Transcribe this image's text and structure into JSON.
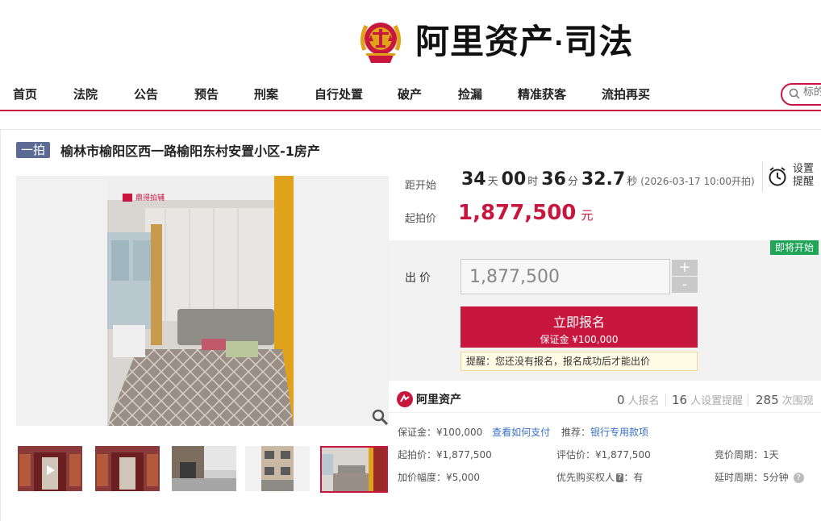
{
  "brand": {
    "name": "阿里资产",
    "dot": "·",
    "sub": "司法"
  },
  "nav": {
    "items": [
      "首页",
      "法院",
      "公告",
      "预告",
      "刑案",
      "自行处置",
      "破产",
      "捡漏",
      "精准获客",
      "流拍再买"
    ],
    "search_placeholder": "标的"
  },
  "listing": {
    "badge": "一拍",
    "title": "榆林市榆阳区西一路榆阳东村安置小区-1房产",
    "watermark": "鼎得拍辅"
  },
  "countdown": {
    "label": "距开始",
    "days": "34",
    "days_unit": "天",
    "hours": "00",
    "hours_unit": "时",
    "minutes": "36",
    "minutes_unit": "分",
    "seconds": "32.7",
    "seconds_unit": "秒",
    "note": "(2026-03-17 10:00开拍)"
  },
  "reminder": {
    "line1": "设置",
    "line2": "提醒"
  },
  "price": {
    "label": "起拍价",
    "value": "1,877,500",
    "unit": "元"
  },
  "bid": {
    "status_tag": "即将开始",
    "label": "出价",
    "input_value": "1,877,500",
    "plus": "+",
    "minus": "-",
    "signup_label": "立即报名",
    "deposit_label": "保证金 ¥100,000",
    "tip": "提醒：您还没有报名，报名成功后才能出价"
  },
  "platform": {
    "name": "阿里资产"
  },
  "stats": [
    {
      "n": "0",
      "u": "人报名"
    },
    {
      "n": "16",
      "u": "人设置提醒"
    },
    {
      "n": "285",
      "u": "次围观"
    }
  ],
  "details": {
    "deposit": "保证金：¥100,000",
    "how_to_pay": "查看如何支付",
    "recommend_label": "推荐：",
    "recommend_link": "银行专用款项",
    "start_price": "起拍价：¥1,877,500",
    "appraisal": "评估价：¥1,877,500",
    "cycle": "竞价周期：1天",
    "increment": "加价幅度：¥5,000",
    "priority_label": "优先购买权人",
    "priority_badge": "?",
    "priority_value": "：有",
    "extension": "延时周期：5分钟",
    "help": "?"
  },
  "colors": {
    "accent": "#c8173f",
    "badge": "#5b6b94",
    "green": "#1fa458",
    "link": "#3a6fc4"
  }
}
